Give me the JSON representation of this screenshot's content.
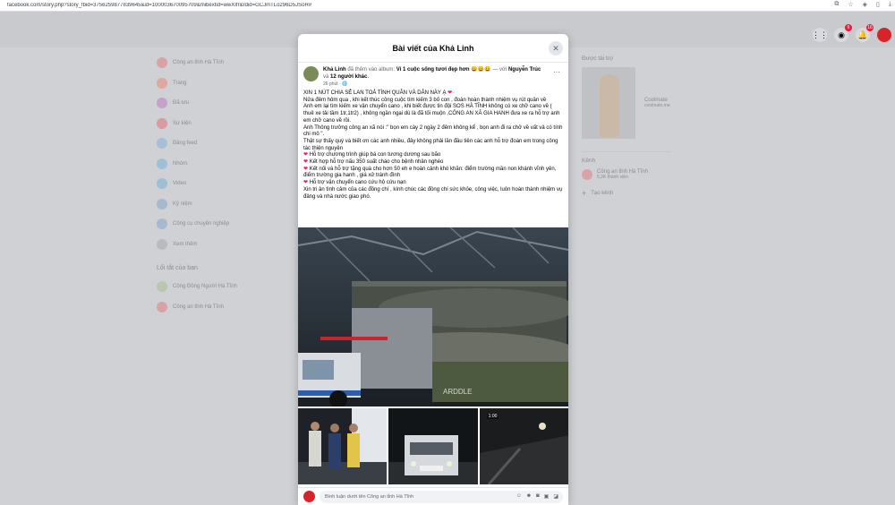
{
  "browser": {
    "url": "facebook.com/story.php?story_fbid=3756259877839645&id=100003670095709&mibextid=wwXIfr&rdid=GCJmTLo296D5JSoR#"
  },
  "topbar": {
    "messenger_badge": "6",
    "notification_badge": "16"
  },
  "left_sidebar": {
    "items": [
      "Công an tỉnh Hà Tĩnh",
      "Trang",
      "Đã lưu",
      "Sự kiện",
      "Bảng feed",
      "Nhóm",
      "Video",
      "Kỷ niệm",
      "Công cụ chuyên nghiệp",
      "Xem thêm"
    ],
    "shortcuts_heading": "Lối tắt của bạn",
    "shortcuts": [
      "Cộng Đồng Người Hà Tĩnh",
      "Công an tỉnh Hà Tĩnh"
    ]
  },
  "right_sidebar": {
    "sponsored_heading": "Được tài trợ",
    "ad_name": "Coolmate",
    "ad_url": "coolmate.me",
    "pages_heading": "Kênh",
    "page_name": "Công an tỉnh Hà Tĩnh",
    "page_meta": "5,2K thành viên",
    "create_label": "Tạo kênh"
  },
  "modal": {
    "title": "Bài viết của Khả Linh",
    "close_icon": "close-icon"
  },
  "post": {
    "author": "Khả Linh",
    "added_to_album": "đã thêm vào album:",
    "album": "Vì 1 cuộc sống tươi đẹp hơn 😀😀😀",
    "with_sep": "— với",
    "with_person": "Nguyễn Trúc",
    "and": "và",
    "others": "12 người khác",
    "time": "26 phút · 🌐",
    "lines": [
      "XIN 1 NÚT CHIA SẺ LAN TOẢ TÌNH QUÂN VÀ DÂN NÀY Ạ",
      "Nửa đêm hôm qua , khi kết thúc công cuộc tìm kiếm 3 bố con , đoàn hoàn thành nhiệm vụ rút quân về",
      "Anh em lại tìm kiếm xe vận chuyển cano , khi biết được tin đội SOS HÀ TĨNH không có xe chở cano về ( thuê xe tải tầm 1tr,1tr2) , không ngần ngại dù là đã tối muộn ,CÔNG AN XÃ GIA HANH đưa xe ra hỗ trợ anh em chở cano về rồi.",
      "Anh Thông trưởng công an xã nói :\" bọn em cày 2 ngày 2 đêm không kể , bọn anh đi ra chở về vất vả có tính chi mô \".",
      "Thật sự thấy quý và biết ơn các anh nhiều, đây không phải lần đầu tiên các anh hỗ trợ đoàn em trong công tác thiện nguyện"
    ],
    "bullets": [
      "Hỗ trợ chương trình giúp bà con tương dương sau bão",
      "Kết hợp hỗ trợ nấu 350 suất cháo cho bệnh nhân nghèo",
      "Kết nối và hỗ trợ tặng quà cho hơn 50 eh e hoàn cảnh khó khăn: điểm trường mần non khánh vĩnh yên, điểm trường gia hanh , giá xử tránh đình",
      "Hỗ trợ vận chuyển cano cứu hộ cứu nạn"
    ],
    "closing": "Xin tri ân tình cảm của các đồng chí , kính chúc các đồng chí sức khỏe, công việc, luôn hoàn thành nhiệm vụ đảng và nhà nước giao phó."
  },
  "photos": {
    "main_plate": "ARDDLE",
    "thumb_timestamp": "1:00"
  },
  "comment": {
    "placeholder": "Bình luận dưới tên Công an tỉnh Hà Tĩnh"
  }
}
